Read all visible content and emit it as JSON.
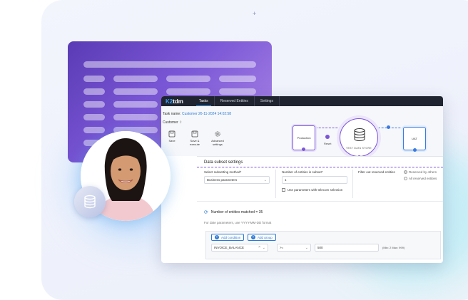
{
  "app": {
    "logo_prefix": "K2",
    "logo_suffix": "tdm",
    "nav": [
      {
        "label": "Tasks",
        "active": true
      },
      {
        "label": "Reserved Entities",
        "active": false
      },
      {
        "label": "Settings",
        "active": false
      }
    ]
  },
  "task": {
    "name_label": "Task name:",
    "name_value": "Customer 26-11-2024 14:02:58",
    "customer_label": "Customer"
  },
  "toolbar": {
    "save": "Save",
    "save_execute_1": "Save &",
    "save_execute_2": "execute",
    "advanced_1": "Advanced",
    "advanced_2": "settings"
  },
  "flow": {
    "source": "Production",
    "step": "Reset",
    "center": "TEST DATA STORE",
    "target": "UAT"
  },
  "subset": {
    "title": "Data subset settings",
    "method_label": "Select subsetting method*",
    "method_value": "Business parameters",
    "entities_label": "Number of entities in subset*",
    "entities_value": "1",
    "telecom_checkbox": "Use parameters with telecom selection",
    "filter_label": "Filter out reserved entities",
    "radio_reserved_by_others": "Reserved by others",
    "radio_all_reserved": "All reserved entities",
    "matched": "Number of entities matched = 35",
    "date_hint": "For date parameters, use YYYY-MM-DD format",
    "add_condition": "Add condition",
    "add_group": "Add group",
    "condition_field": "INVOICE_BALANCE",
    "condition_operator": ">=",
    "condition_value": "500",
    "condition_range": "(Min: 2 Max: 999)"
  },
  "colors": {
    "accent_purple": "#7b57d6",
    "accent_blue": "#2d7ad6",
    "topbar": "#1f2430"
  }
}
